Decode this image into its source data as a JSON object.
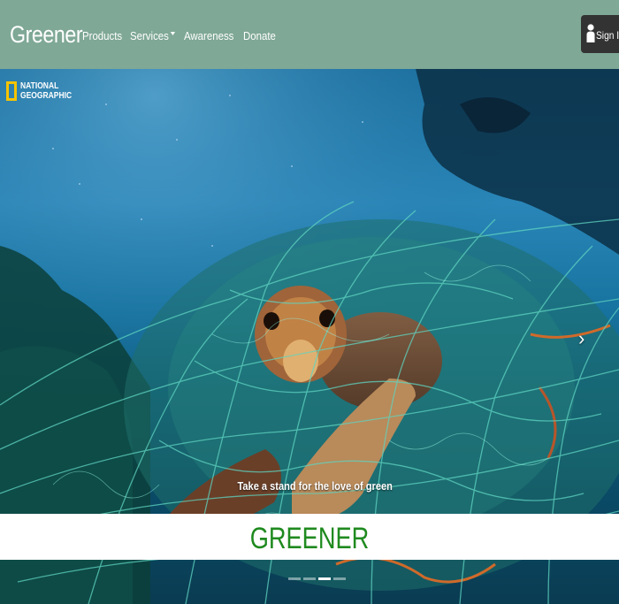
{
  "navbar": {
    "brand": "Greener",
    "items": [
      {
        "label": "Products"
      },
      {
        "label": "Services",
        "has_dropdown": true
      },
      {
        "label": "Awareness"
      },
      {
        "label": "Donate"
      }
    ],
    "signin_label": "Sign In",
    "color": "#7fa896"
  },
  "hero": {
    "logo_line1": "NATIONAL",
    "logo_line2": "GEOGRAPHIC",
    "caption": "Take a stand for the love of green",
    "next_icon": "chevron-right-icon",
    "indicator_count": 4,
    "active_indicator": 3
  },
  "banner": {
    "title": "GREENER",
    "color": "#1f8a1f"
  }
}
